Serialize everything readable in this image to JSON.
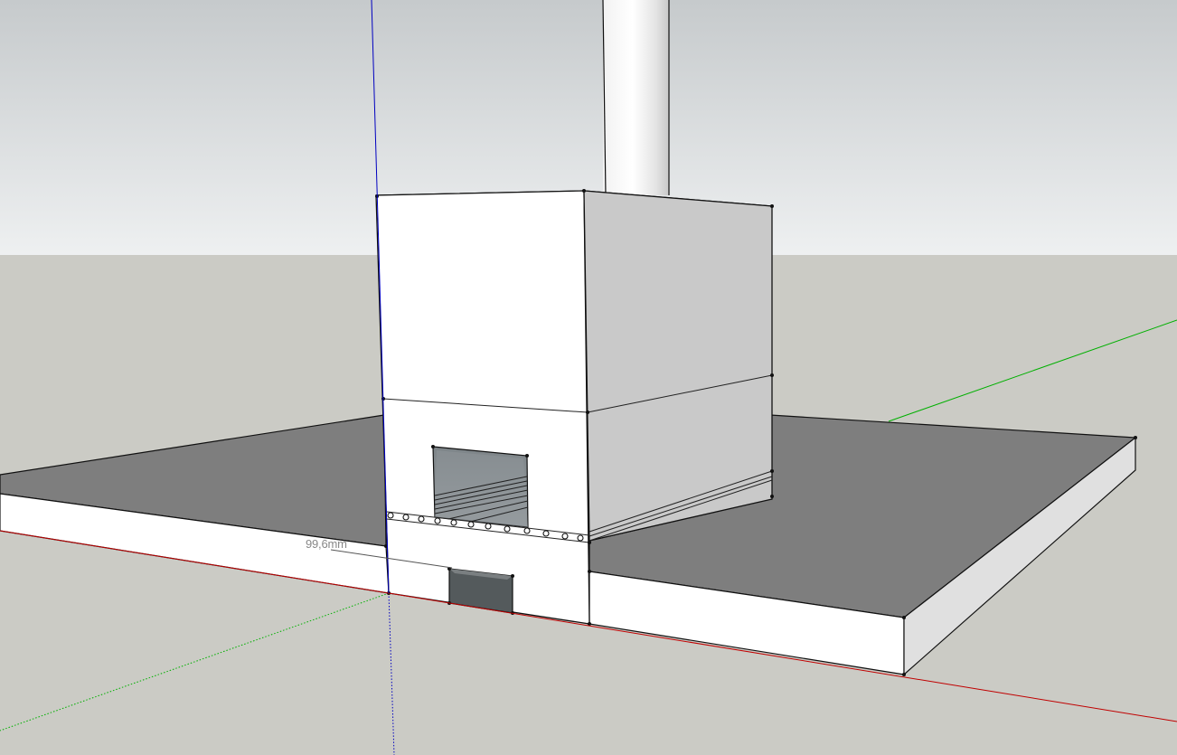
{
  "measurement": {
    "dimension_text": "99,6mm"
  },
  "axes": {
    "red_axis_color": "#c00000",
    "green_axis_color": "#00b000",
    "blue_axis_color": "#0000c0"
  },
  "colors": {
    "sky_top": "#c6cacc",
    "sky_bottom": "#eef0f1",
    "ground": "#cbcbc5",
    "slab_top": "#7e7e7e",
    "face_light": "#ffffff",
    "face_side": "#c9c9c9",
    "opening_dark": "#545a5c"
  }
}
